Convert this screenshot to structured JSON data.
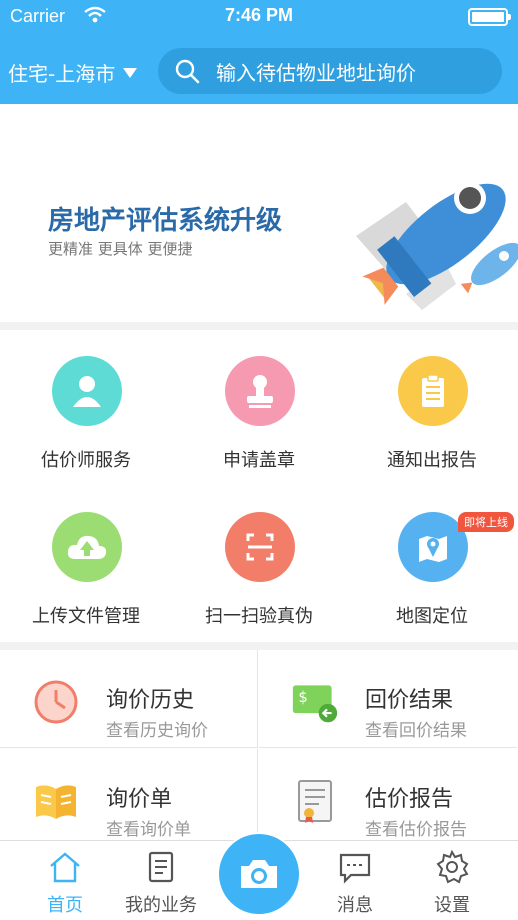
{
  "status_bar": {
    "carrier": "Carrier",
    "time": "7:46 PM"
  },
  "header": {
    "city_selector": "住宅-上海市",
    "search_placeholder": "输入待估物业地址询价"
  },
  "banner": {
    "title": "房地产评估系统升级",
    "subtitle": "更精准  更具体  更便捷"
  },
  "services": [
    {
      "label": "估价师服务",
      "icon": "appraiser-icon",
      "color": "#5fdbd6"
    },
    {
      "label": "申请盖章",
      "icon": "stamp-icon",
      "color": "#f59ab0"
    },
    {
      "label": "通知出报告",
      "icon": "clipboard-icon",
      "color": "#fbc94a"
    },
    {
      "label": "上传文件管理",
      "icon": "cloud-upload-icon",
      "color": "#9bdd72"
    },
    {
      "label": "扫一扫验真伪",
      "icon": "scan-icon",
      "color": "#f27e6a"
    },
    {
      "label": "地图定位",
      "icon": "map-icon",
      "color": "#56b1f0"
    }
  ],
  "coming_soon_badge": "即将上线",
  "cards": [
    {
      "title": "询价历史",
      "subtitle": "查看历史询价",
      "icon": "clock-icon"
    },
    {
      "title": "回价结果",
      "subtitle": "查看回价结果",
      "icon": "price-result-icon"
    },
    {
      "title": "询价单",
      "subtitle": "查看询价单",
      "icon": "book-icon"
    },
    {
      "title": "估价报告",
      "subtitle": "查看估价报告",
      "icon": "certificate-icon"
    }
  ],
  "tabbar": {
    "home": "首页",
    "my_business": "我的业务",
    "messages": "消息",
    "settings": "设置",
    "active_color": "#3eb4f6"
  }
}
